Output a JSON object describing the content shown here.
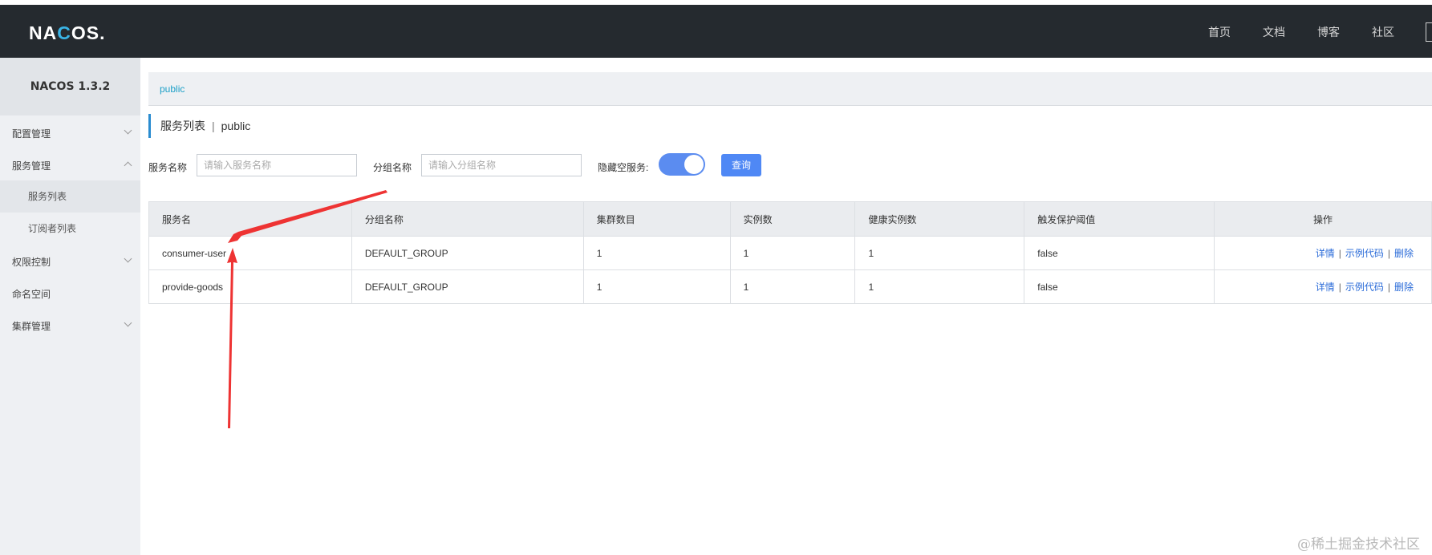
{
  "header": {
    "logo": "NACOS.",
    "nav": [
      "首页",
      "文档",
      "博客",
      "社区"
    ]
  },
  "sidebar": {
    "title": "NACOS 1.3.2",
    "items": {
      "config": "配置管理",
      "service": "服务管理",
      "service_list": "服务列表",
      "subscriber_list": "订阅者列表",
      "auth": "权限控制",
      "namespace": "命名空间",
      "cluster": "集群管理"
    }
  },
  "breadcrumb": {
    "namespace": "public"
  },
  "page": {
    "title": "服务列表",
    "separator": "|",
    "namespace": "public"
  },
  "filters": {
    "service_label": "服务名称",
    "service_placeholder": "请输入服务名称",
    "group_label": "分组名称",
    "group_placeholder": "请输入分组名称",
    "hide_empty_label": "隐藏空服务:",
    "hide_empty_on": true,
    "query_button": "查询"
  },
  "table": {
    "columns": [
      "服务名",
      "分组名称",
      "集群数目",
      "实例数",
      "健康实例数",
      "触发保护阈值",
      "操作"
    ],
    "rows": [
      {
        "name": "consumer-user",
        "group": "DEFAULT_GROUP",
        "clusters": "1",
        "instances": "1",
        "healthy": "1",
        "threshold": "false"
      },
      {
        "name": "provide-goods",
        "group": "DEFAULT_GROUP",
        "clusters": "1",
        "instances": "1",
        "healthy": "1",
        "threshold": "false"
      }
    ],
    "actions": {
      "detail": "详情",
      "sample_code": "示例代码",
      "delete": "删除",
      "sep": "|"
    }
  },
  "watermark": "@稀土掘金技术社区",
  "colors": {
    "header_bg": "#252a2f",
    "accent": "#4f88f5",
    "annotation": "#ee3333"
  }
}
